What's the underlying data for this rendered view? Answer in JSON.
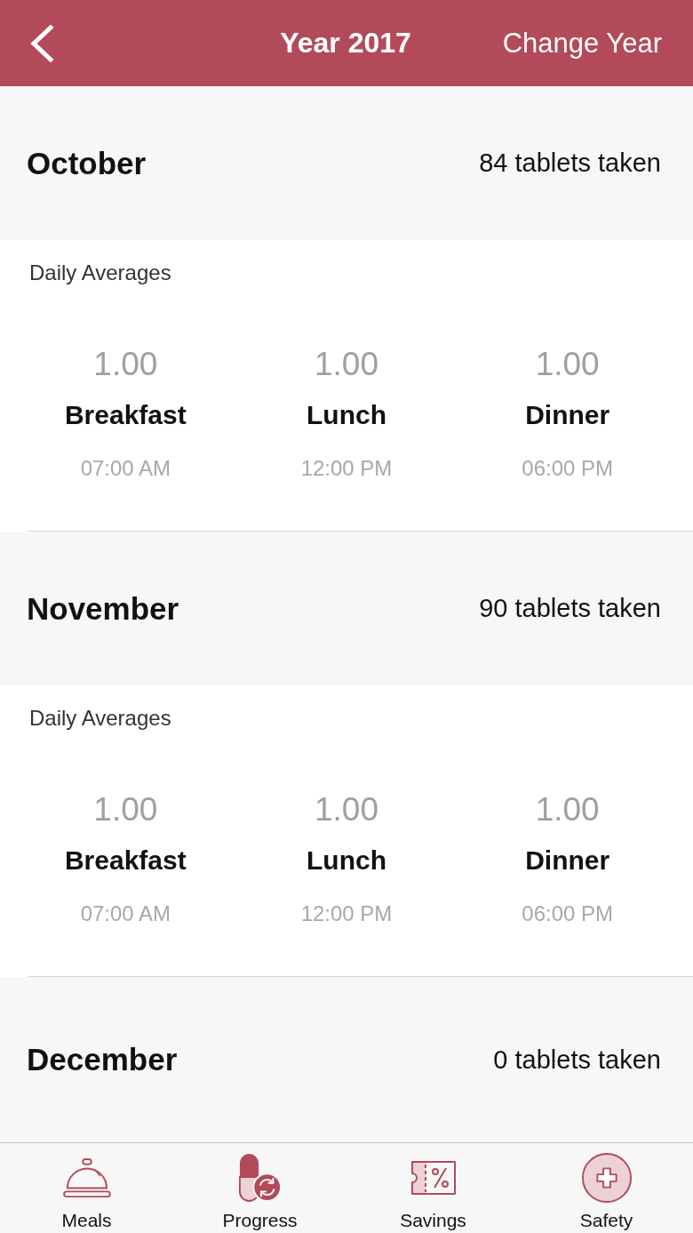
{
  "header": {
    "title": "Year 2017",
    "action": "Change Year"
  },
  "months": [
    {
      "name": "October",
      "count": "84 tablets taken",
      "averages_label": "Daily Averages",
      "meals": [
        {
          "value": "1.00",
          "name": "Breakfast",
          "time": "07:00 AM"
        },
        {
          "value": "1.00",
          "name": "Lunch",
          "time": "12:00 PM"
        },
        {
          "value": "1.00",
          "name": "Dinner",
          "time": "06:00 PM"
        }
      ]
    },
    {
      "name": "November",
      "count": "90 tablets taken",
      "averages_label": "Daily Averages",
      "meals": [
        {
          "value": "1.00",
          "name": "Breakfast",
          "time": "07:00 AM"
        },
        {
          "value": "1.00",
          "name": "Lunch",
          "time": "12:00 PM"
        },
        {
          "value": "1.00",
          "name": "Dinner",
          "time": "06:00 PM"
        }
      ]
    },
    {
      "name": "December",
      "count": "0 tablets taken"
    }
  ],
  "tab_bar": {
    "items": [
      {
        "label": "Meals",
        "kind": "meals"
      },
      {
        "label": "Progress",
        "kind": "progress"
      },
      {
        "label": "Savings",
        "kind": "savings"
      },
      {
        "label": "Safety",
        "kind": "safety"
      }
    ]
  }
}
